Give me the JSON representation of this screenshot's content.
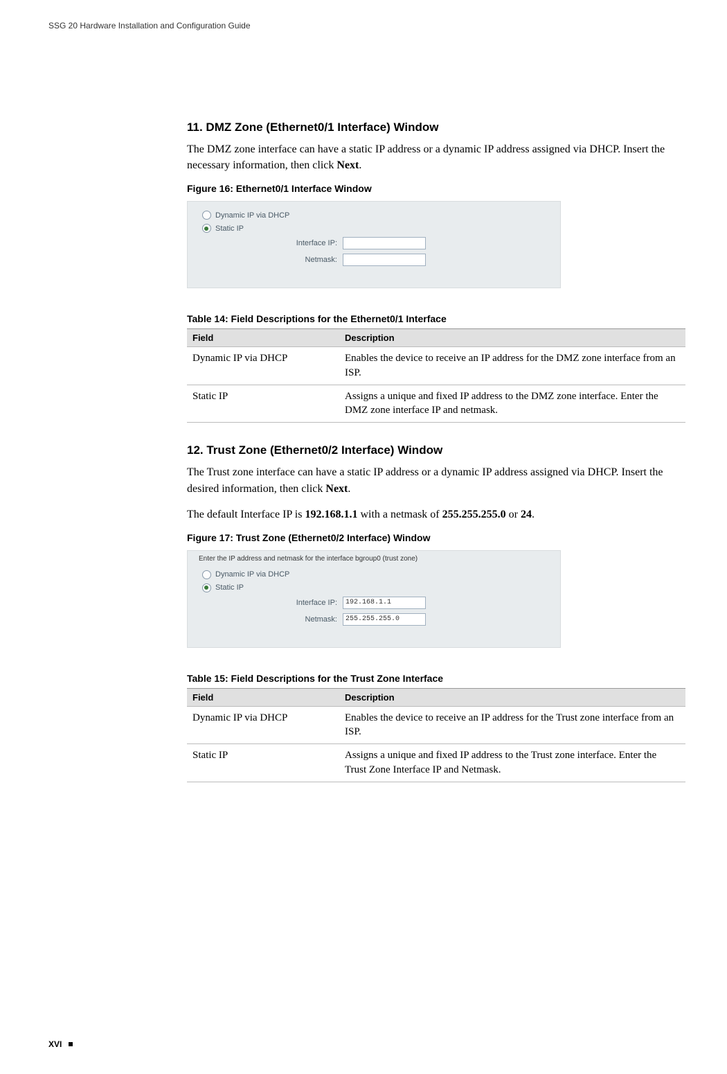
{
  "header": {
    "title": "SSG 20 Hardware Installation and Configuration Guide"
  },
  "s11": {
    "heading": "11. DMZ Zone (Ethernet0/1 Interface) Window",
    "para_a": "The DMZ zone interface can have a static IP address or a dynamic IP address assigned via DHCP. Insert the necessary information, then click ",
    "para_b_bold": "Next",
    "para_c": ".",
    "fig_caption": "Figure 16:  Ethernet0/1 Interface Window",
    "panel": {
      "opt_dhcp": "Dynamic IP via DHCP",
      "opt_static": "Static IP",
      "lbl_ip": "Interface IP:",
      "lbl_mask": "Netmask:",
      "val_ip": "",
      "val_mask": ""
    },
    "tbl_caption": "Table 14:  Field Descriptions for the Ethernet0/1 Interface",
    "tbl_h1": "Field",
    "tbl_h2": "Description",
    "r1c1": "Dynamic IP via DHCP",
    "r1c2": "Enables the device to receive an IP address for the DMZ zone interface from an ISP.",
    "r2c1": "Static IP",
    "r2c2": "Assigns a unique and fixed IP address to the DMZ zone interface. Enter the DMZ zone interface IP and netmask."
  },
  "s12": {
    "heading": "12. Trust Zone (Ethernet0/2 Interface) Window",
    "para1_a": "The Trust zone interface can have a static IP address or a dynamic IP address assigned via DHCP. Insert the desired information, then click ",
    "para1_b_bold": "Next",
    "para1_c": ".",
    "para2_a": "The default Interface IP is ",
    "para2_b_bold": "192.168.1.1",
    "para2_c": " with a netmask of ",
    "para2_d_bold": "255.255.255.0",
    "para2_e": " or ",
    "para2_f_bold": "24",
    "para2_g": ".",
    "fig_caption": "Figure 17:  Trust Zone (Ethernet0/2 Interface) Window",
    "panel": {
      "instr": "Enter the IP address and netmask for the interface bgroup0 (trust zone)",
      "opt_dhcp": "Dynamic IP via DHCP",
      "opt_static": "Static IP",
      "lbl_ip": "Interface IP:",
      "lbl_mask": "Netmask:",
      "val_ip": "192.168.1.1",
      "val_mask": "255.255.255.0"
    },
    "tbl_caption": "Table 15:  Field Descriptions for the Trust Zone Interface",
    "tbl_h1": "Field",
    "tbl_h2": "Description",
    "r1c1": "Dynamic IP via DHCP",
    "r1c2": "Enables the device to receive an IP address for the Trust zone interface from an ISP.",
    "r2c1": "Static IP",
    "r2c2": "Assigns a unique and fixed IP address to the Trust zone interface. Enter the Trust Zone Interface IP and Netmask."
  },
  "footer": {
    "page": "XVI"
  }
}
